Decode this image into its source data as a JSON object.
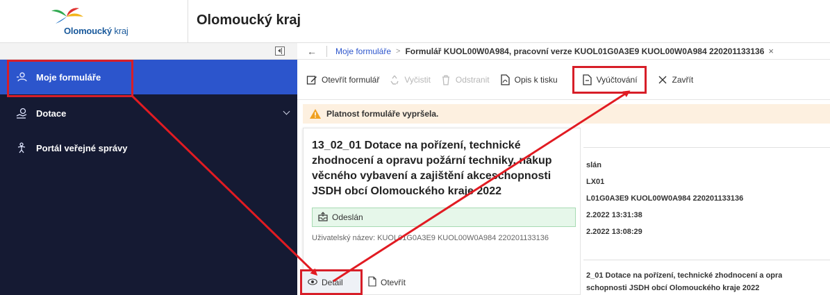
{
  "header": {
    "logo_name": "Olomoucký",
    "logo_suffix": " kraj",
    "title": "Olomoucký kraj"
  },
  "sidebar": {
    "items": [
      {
        "label": "Moje formuláře",
        "icon": "user-form-icon",
        "active": true
      },
      {
        "label": "Dotace",
        "icon": "money-hand-icon",
        "has_submenu": true
      },
      {
        "label": "Portál veřejné správy",
        "icon": "portal-figure-icon"
      }
    ]
  },
  "breadcrumb": {
    "back": "←",
    "link": "Moje formuláře",
    "separator": ">",
    "current": "Formulář KUOL00W0A984, pracovní verze KUOL01G0A3E9 KUOL00W0A984 220201133136",
    "close": "×"
  },
  "toolbar": {
    "open_label": "Otevřít formulář",
    "clear_label": "Vyčistit",
    "delete_label": "Odstranit",
    "print_label": "Opis k tisku",
    "billing_label": "Vyúčtování",
    "close_label": "Zavřít"
  },
  "warning": {
    "text": "Platnost formuláře vypršela."
  },
  "card": {
    "title": "13_02_01 Dotace na pořízení, technické zhodnocení a opravu požární techniky, nákup věcného vybavení a zajištění akceschopnosti JSDH obcí Olomouckého kraje 2022",
    "status": "Odeslán",
    "user_name_label": "Uživatelský název: KUOL01G0A3E9 KUOL00W0A984 220201133136",
    "detail_label": "Detail",
    "open_label": "Otevřít"
  },
  "detail_panel": {
    "lines": [
      "slán",
      "LX01",
      "L01G0A3E9 KUOL00W0A984 220201133136",
      "2.2022 13:31:38",
      "2.2022 13:08:29"
    ],
    "bottom_line1": "2_01 Dotace na pořízení, technické zhodnocení a opra",
    "bottom_line2": "schopnosti JSDH obcí Olomouckého kraje 2022"
  },
  "colors": {
    "sidebar_bg": "#151a33",
    "active_item": "#2c55cc",
    "highlight_red": "#d71e28",
    "warning_bg": "#fdf0e0",
    "status_green": "#e6f7ea"
  }
}
